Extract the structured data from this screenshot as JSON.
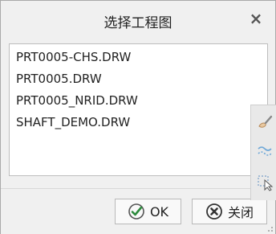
{
  "dialog": {
    "title": "选择工程图",
    "close_glyph": "×"
  },
  "list": {
    "items": [
      "PRT0005-CHS.DRW",
      "PRT0005.DRW",
      "PRT0005_NRID.DRW",
      "SHAFT_DEMO.DRW"
    ]
  },
  "buttons": {
    "ok_label": "OK",
    "close_label": "关闭"
  },
  "colors": {
    "ok_icon": "#2c8a3c",
    "close_icon": "#333333"
  }
}
